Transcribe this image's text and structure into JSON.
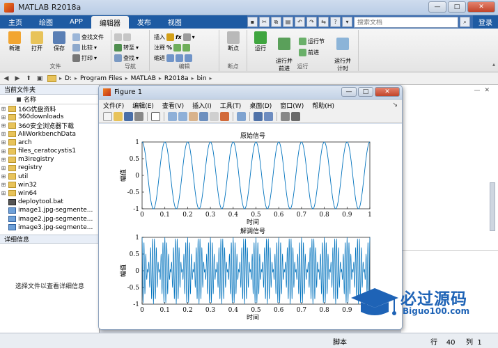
{
  "window": {
    "title": "MATLAB R2018a"
  },
  "tabs": [
    {
      "label": "主页"
    },
    {
      "label": "绘图"
    },
    {
      "label": "APP"
    },
    {
      "label": "编辑器"
    },
    {
      "label": "发布"
    },
    {
      "label": "视图"
    }
  ],
  "search": {
    "placeholder": "搜索文档"
  },
  "login_label": "登录",
  "ribbon": {
    "file_group": {
      "label": "文件",
      "new": "新建",
      "open": "打开",
      "save": "保存",
      "find_files": "查找文件",
      "compare": "比较",
      "print": "打印"
    },
    "nav_group": {
      "label": "导航",
      "goto": "转至",
      "find": "查找"
    },
    "edit_group": {
      "label": "编辑",
      "insert": "插入",
      "comment": "注释",
      "indent": "缩进"
    },
    "breakpoints_group": {
      "label": "断点",
      "breakpoint": "断点"
    },
    "run_group": {
      "label": "运行",
      "run": "运行",
      "run_advance": "运行并\n前进",
      "run_section": "运行节",
      "advance": "前进",
      "run_time": "运行并\n计时"
    }
  },
  "breadcrumb": [
    "D:",
    "Program Files",
    "MATLAB",
    "R2018a",
    "bin"
  ],
  "current_folder": {
    "title": "当前文件夹",
    "column": "名称",
    "items": [
      {
        "name": "16G优盘资料",
        "type": "folder"
      },
      {
        "name": "360downloads",
        "type": "folder"
      },
      {
        "name": "360安全浏览器下载",
        "type": "folder"
      },
      {
        "name": "AliWorkbenchData",
        "type": "folder"
      },
      {
        "name": "arch",
        "type": "folder"
      },
      {
        "name": "files_ceratocystis1",
        "type": "folder"
      },
      {
        "name": "m3iregistry",
        "type": "folder"
      },
      {
        "name": "registry",
        "type": "folder"
      },
      {
        "name": "util",
        "type": "folder"
      },
      {
        "name": "win32",
        "type": "folder"
      },
      {
        "name": "win64",
        "type": "folder"
      },
      {
        "name": "deploytool.bat",
        "type": "bat"
      },
      {
        "name": "image1.jpg-segmente...",
        "type": "img"
      },
      {
        "name": "image2.jpg-segmente...",
        "type": "img"
      },
      {
        "name": "image3.jpg-segmente...",
        "type": "img"
      }
    ]
  },
  "details": {
    "title": "详细信息",
    "message": "选择文件以查看详细信息"
  },
  "figure": {
    "title": "Figure 1",
    "menus": [
      "文件(F)",
      "编辑(E)",
      "查看(V)",
      "插入(I)",
      "工具(T)",
      "桌面(D)",
      "窗口(W)",
      "帮助(H)"
    ]
  },
  "chart_data": [
    {
      "type": "line",
      "title": "原始信号",
      "xlabel": "时间",
      "ylabel": "幅值",
      "xlim": [
        0,
        1
      ],
      "ylim": [
        -1,
        1
      ],
      "x_ticks": [
        "0",
        "0.1",
        "0.2",
        "0.3",
        "0.4",
        "0.5",
        "0.6",
        "0.7",
        "0.8",
        "0.9",
        "1"
      ],
      "y_ticks": [
        "-1",
        "-0.5",
        "0",
        "0.5",
        "1"
      ],
      "series": [
        {
          "function": "cos(2*pi*10*t)",
          "frequency_hz": 10,
          "amplitude": 1,
          "color": "#0072bd"
        }
      ]
    },
    {
      "type": "line",
      "title": "解调信号",
      "xlabel": "时间",
      "ylabel": "幅值",
      "xlim": [
        0,
        1
      ],
      "ylim": [
        -1,
        1
      ],
      "x_ticks": [
        "0",
        "0.1",
        "0.2",
        "0.3",
        "0.4",
        "0.5",
        "0.6",
        "0.7",
        "0.8",
        "0.9",
        "1"
      ],
      "y_ticks": [
        "-1",
        "-0.5",
        "0",
        "0.5",
        "1"
      ],
      "series": [
        {
          "function": "cos(2*pi*10*t)*cos(2*pi*120*t) modulated",
          "frequency_hz": 120,
          "envelope_hz": 10,
          "amplitude": 1,
          "color": "#0072bd"
        }
      ]
    }
  ],
  "status": {
    "mode": "脚本",
    "row_label": "行",
    "row": "40",
    "col_label": "列",
    "col": "1"
  },
  "watermark": {
    "text": "必过源码",
    "sub": "Biguo100.com"
  }
}
